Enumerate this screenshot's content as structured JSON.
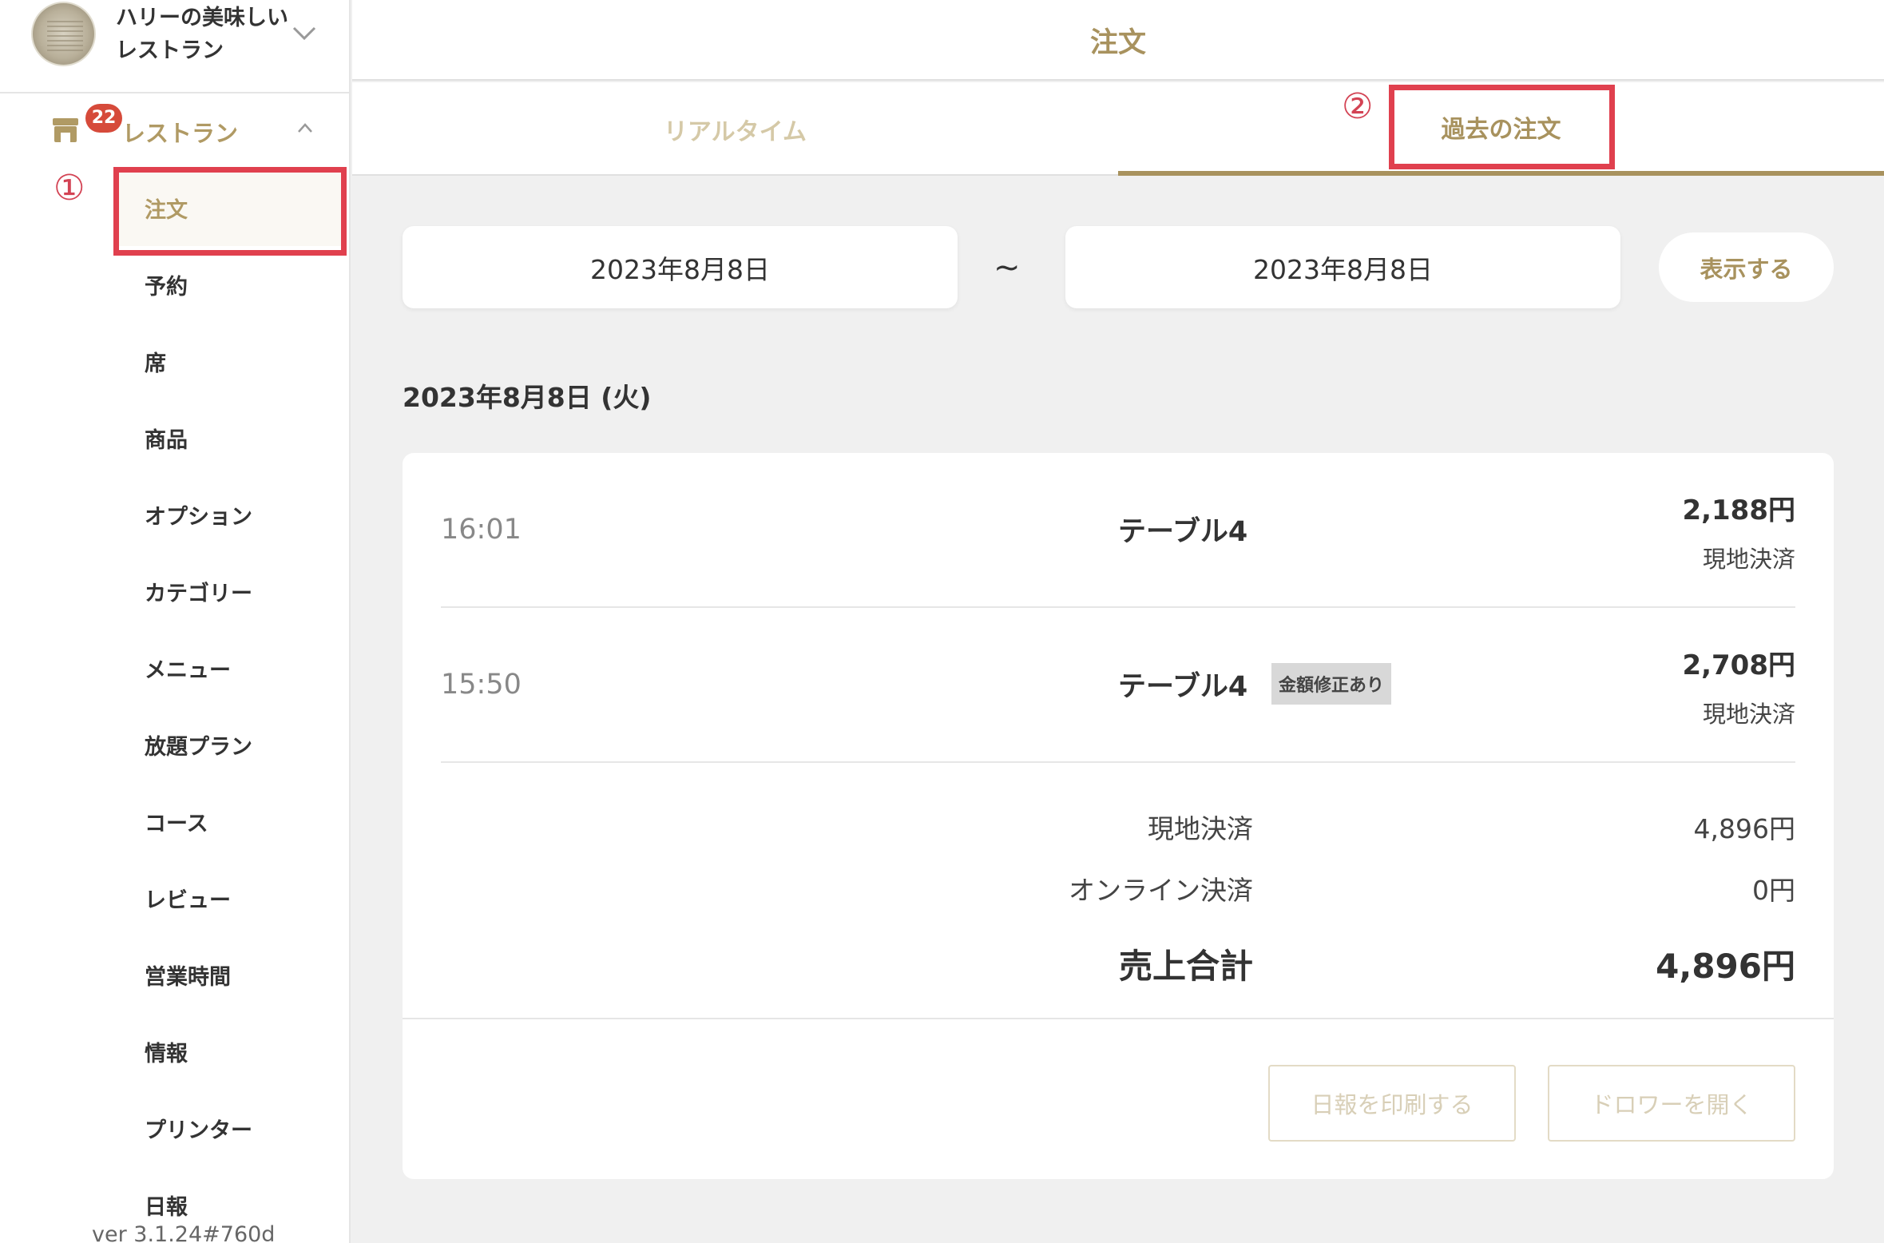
{
  "sidebar": {
    "restaurant_name_line1": "ハリーの美味しい",
    "restaurant_name_line2": "レストラン",
    "section": {
      "label": "レストラン",
      "badge": "22"
    },
    "items": [
      {
        "label": "注文",
        "active": true
      },
      {
        "label": "予約"
      },
      {
        "label": "席"
      },
      {
        "label": "商品"
      },
      {
        "label": "オプション"
      },
      {
        "label": "カテゴリー"
      },
      {
        "label": "メニュー"
      },
      {
        "label": "放題プラン"
      },
      {
        "label": "コース"
      },
      {
        "label": "レビュー"
      },
      {
        "label": "営業時間"
      },
      {
        "label": "情報"
      },
      {
        "label": "プリンター"
      },
      {
        "label": "日報"
      }
    ],
    "version": "ver 3.1.24#760d"
  },
  "annotations": {
    "one": "①",
    "two": "②"
  },
  "header": {
    "title": "注文"
  },
  "tabs": {
    "realtime": "リアルタイム",
    "past": "過去の注文",
    "active": "past"
  },
  "filter": {
    "start_date": "2023年8月8日",
    "separator": "~",
    "end_date": "2023年8月8日",
    "show_button": "表示する"
  },
  "day": {
    "heading": "2023年8月8日 (火)",
    "orders": [
      {
        "time": "16:01",
        "table": "テーブル4",
        "amount": "2,188円",
        "method": "現地決済",
        "badge": ""
      },
      {
        "time": "15:50",
        "table": "テーブル4",
        "amount": "2,708円",
        "method": "現地決済",
        "badge": "金額修正あり"
      }
    ],
    "summary": {
      "onsite_label": "現地決済",
      "onsite_value": "4,896円",
      "online_label": "オンライン決済",
      "online_value": "0円",
      "total_label": "売上合計",
      "total_value": "4,896円"
    },
    "buttons": {
      "print_report": "日報を印刷する",
      "open_drawer": "ドロワーを開く"
    }
  },
  "colors": {
    "accent": "#a8925e",
    "badge": "#d64a3a",
    "highlight": "#e0404e"
  }
}
